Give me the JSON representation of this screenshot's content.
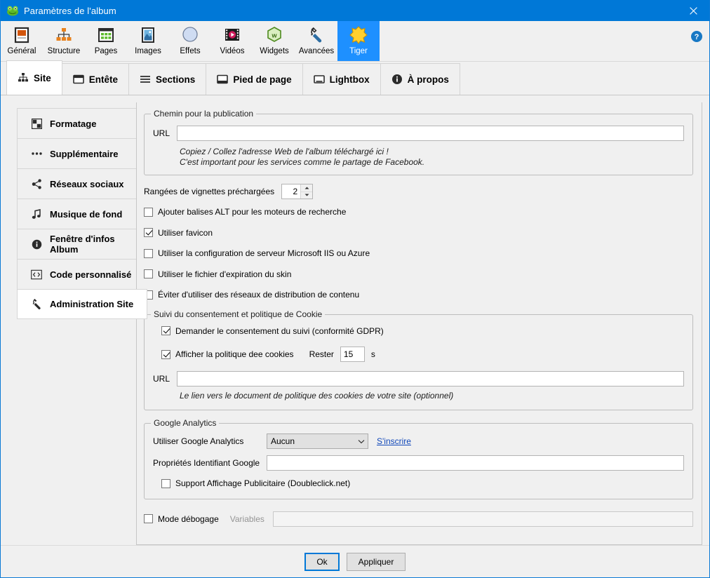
{
  "window": {
    "title": "Paramètres de l'album",
    "app_icon": "frog-icon",
    "close_label": "✕",
    "titlebar_color": "#0078d7"
  },
  "ribbon": {
    "help_icon": "help-icon",
    "tabs": [
      {
        "label": "Général",
        "icon": "image-frame-icon",
        "selected": false
      },
      {
        "label": "Structure",
        "icon": "sitemap-icon",
        "selected": false
      },
      {
        "label": "Pages",
        "icon": "grid-pages-icon",
        "selected": false
      },
      {
        "label": "Images",
        "icon": "picture-icon",
        "selected": false
      },
      {
        "label": "Effets",
        "icon": "circle-icon",
        "selected": false
      },
      {
        "label": "Vidéos",
        "icon": "film-play-icon",
        "selected": false
      },
      {
        "label": "Widgets",
        "icon": "hexagon-w-icon",
        "selected": false
      },
      {
        "label": "Avancées",
        "icon": "wrench-icon",
        "selected": false
      },
      {
        "label": "Tiger",
        "icon": "tiger-star-icon",
        "selected": true
      }
    ],
    "selected_color": "#1e90ff"
  },
  "subtabs": [
    {
      "label": "Site",
      "icon": "sitemap-icon",
      "selected": true
    },
    {
      "label": "Entête",
      "icon": "header-icon",
      "selected": false
    },
    {
      "label": "Sections",
      "icon": "hamburger-icon",
      "selected": false
    },
    {
      "label": "Pied de page",
      "icon": "footer-icon",
      "selected": false
    },
    {
      "label": "Lightbox",
      "icon": "lightbox-icon",
      "selected": false
    },
    {
      "label": "À propos",
      "icon": "info-icon",
      "selected": false
    }
  ],
  "sidebar": {
    "items": [
      {
        "label": "Formatage",
        "icon": "layout-squares-icon",
        "selected": false
      },
      {
        "label": "Supplémentaire",
        "icon": "ellipsis-icon",
        "selected": false
      },
      {
        "label": "Réseaux sociaux",
        "icon": "share-icon",
        "selected": false
      },
      {
        "label": "Musique de fond",
        "icon": "music-note-icon",
        "selected": false
      },
      {
        "label": "Fenêtre d'infos Album",
        "icon": "info-icon",
        "selected": false
      },
      {
        "label": "Code personnalisé",
        "icon": "code-brackets-icon",
        "selected": false
      },
      {
        "label": "Administration Site",
        "icon": "wrench-icon",
        "selected": true
      }
    ]
  },
  "main": {
    "publication": {
      "legend": "Chemin pour la publication",
      "url_label": "URL",
      "url_value": "",
      "url_placeholder": "",
      "hint_line1": "Copiez / Collez l'adresse Web de l'album téléchargé ici !",
      "hint_line2": "C'est important pour les services comme le partage de Facebook."
    },
    "preload": {
      "label": "Rangées de vignettes préchargées",
      "value": "2"
    },
    "checkboxes": [
      {
        "label": "Ajouter balises ALT pour les moteurs de recherche",
        "checked": false
      },
      {
        "label": "Utiliser favicon",
        "checked": true
      },
      {
        "label": "Utiliser la configuration de serveur Microsoft IIS ou Azure",
        "checked": false
      },
      {
        "label": "Utiliser le fichier d'expiration du skin",
        "checked": false
      },
      {
        "label": "Éviter d'utiliser des réseaux de distribution de contenu",
        "checked": false
      }
    ],
    "cookie": {
      "legend": "Suivi du consentement et politique de Cookie",
      "consent_label": "Demander le consentement du suivi (conformité GDPR)",
      "consent_checked": true,
      "policy_label": "Afficher la politique dee cookies",
      "policy_checked": true,
      "stay_label": "Rester",
      "stay_value": "15",
      "stay_unit": "s",
      "url_label": "URL",
      "url_value": "",
      "hint": "Le lien vers le document de politique des cookies de votre site (optionnel)"
    },
    "analytics": {
      "legend": "Google Analytics",
      "use_label": "Utiliser Google Analytics",
      "use_value": "Aucun",
      "use_options": [
        "Aucun"
      ],
      "signup_link": "S'inscrire",
      "property_label": "Propriétés Identifiant Google",
      "property_value": "",
      "adsupport_label": "Support Affichage Publicitaire (Doubleclick.net)",
      "adsupport_checked": false
    },
    "debug": {
      "label": "Mode débogage",
      "checked": false,
      "variables_label": "Variables",
      "variables_value": ""
    }
  },
  "footer": {
    "ok_label": "Ok",
    "apply_label": "Appliquer"
  }
}
